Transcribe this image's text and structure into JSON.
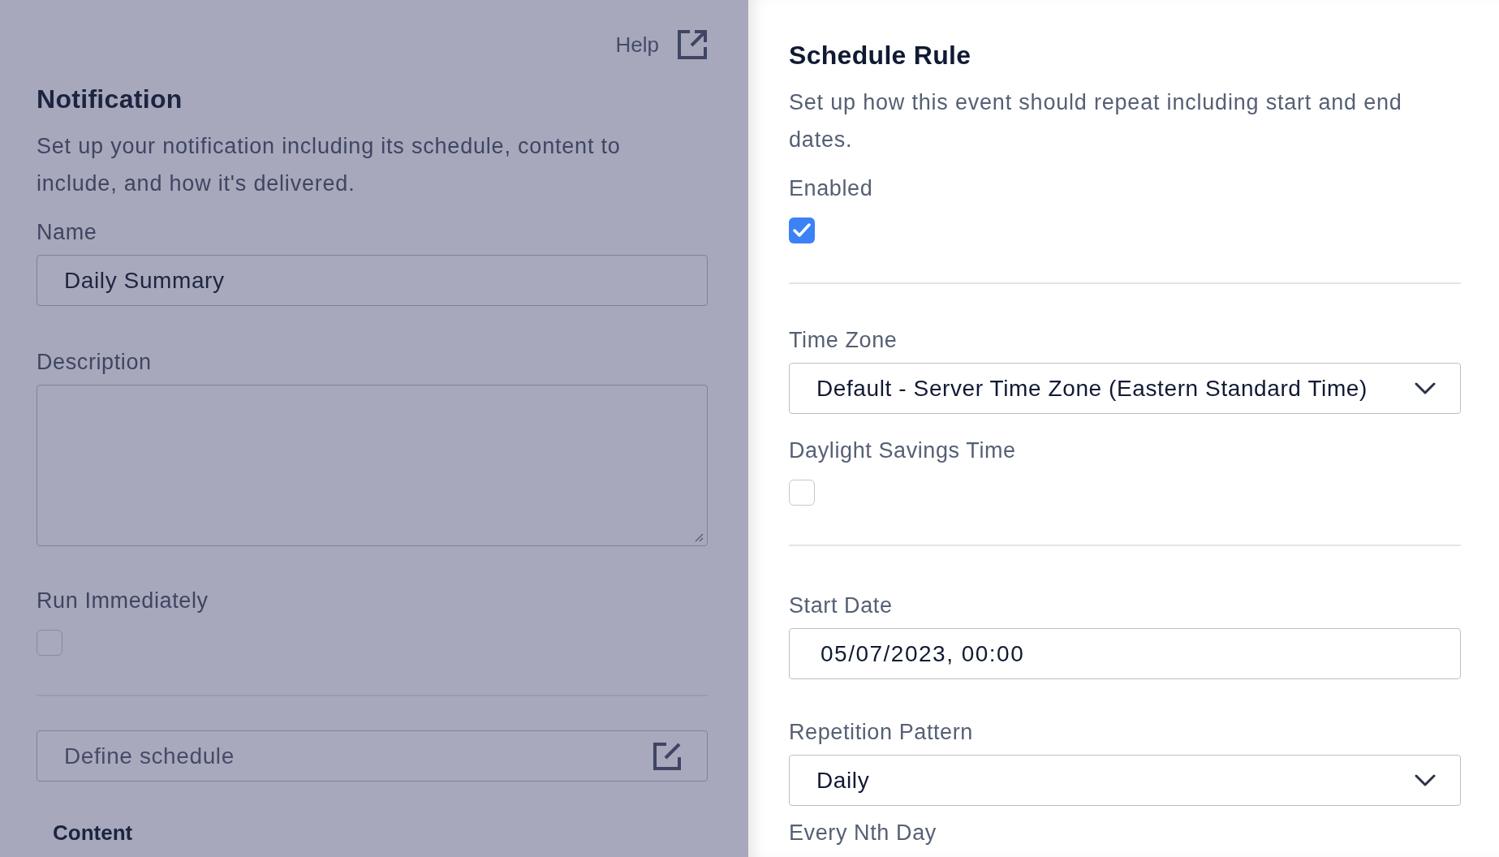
{
  "help": {
    "label": "Help"
  },
  "notification": {
    "title": "Notification",
    "description": "Set up your notification including its schedule, content to include, and how it's delivered.",
    "name": {
      "label": "Name",
      "value": "Daily Summary"
    },
    "description_field": {
      "label": "Description"
    },
    "run_immediately": {
      "label": "Run Immediately",
      "checked": false
    },
    "schedule_field": {
      "placeholder": "Define schedule"
    },
    "content_heading": "Content"
  },
  "schedule_rule": {
    "title": "Schedule Rule",
    "description": "Set up how this event should repeat including start and end dates.",
    "enabled": {
      "label": "Enabled",
      "checked": true
    },
    "time_zone": {
      "label": "Time Zone",
      "value": "Default - Server Time Zone (Eastern Standard Time)"
    },
    "daylight_savings": {
      "label": "Daylight Savings Time",
      "checked": false
    },
    "start_date": {
      "label": "Start Date",
      "value": "05/07/2023, 00:00"
    },
    "repetition_pattern": {
      "label": "Repetition Pattern",
      "value": "Daily"
    },
    "every_nth_day": {
      "label": "Every Nth Day"
    }
  }
}
